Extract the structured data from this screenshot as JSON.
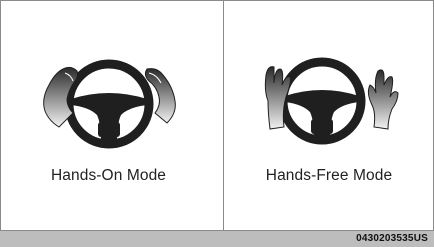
{
  "panels": [
    {
      "caption": "Hands-On Mode",
      "icon": "steering-wheel-hands-on-icon"
    },
    {
      "caption": "Hands-Free Mode",
      "icon": "steering-wheel-hands-free-icon"
    }
  ],
  "footer": {
    "code": "0430203535US"
  },
  "colors": {
    "icon": "#1f1f1f",
    "hand_gradient_light": "#f2f2f2",
    "hand_gradient_dark": "#2a2a2a",
    "border": "#8a8a8a",
    "footer_bar": "#bdbdbd"
  }
}
